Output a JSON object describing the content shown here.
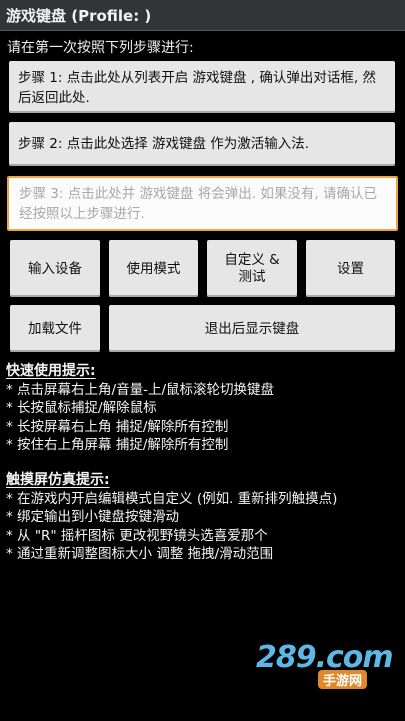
{
  "title": "游戏键盘 (Profile: )",
  "intro": "请在第一次按照下列步骤进行:",
  "steps": {
    "step1": "步骤 1: 点击此处从列表开启 游戏键盘 , 确认弹出对话框, 然后返回此处.",
    "step2": "步骤 2: 点击此处选择 游戏键盘 作为激活输入法.",
    "step3": "步骤 3: 点击此处并 游戏键盘 将会弹出. 如果没有, 请确认已经按照以上步骤进行."
  },
  "buttons": {
    "input_device": "输入设备",
    "mode": "使用模式",
    "customize_line1": "自定义 &",
    "customize_line2": "测试",
    "settings": "设置",
    "load_file": "加载文件",
    "show_keyboard": "退出后显示键盘"
  },
  "quick_tips": {
    "heading": "快速使用提示:",
    "items": [
      "* 点击屏幕右上角/音量-上/鼠标滚轮切换键盘",
      "* 长按鼠标捕捉/解除鼠标",
      "* 长按屏幕右上角 捕捉/解除所有控制",
      "* 按住右上角屏幕 捕捉/解除所有控制"
    ]
  },
  "touch_tips": {
    "heading": "触摸屏仿真提示:",
    "items": [
      "* 在游戏内开启编辑模式自定义 (例如. 重新排列触摸点)",
      "* 绑定输出到小键盘按键滑动",
      "* 从 \"R\" 摇杆图标 更改视野镜头选喜爱那个",
      "* 通过重新调整图标大小 调整 拖拽/滑动范围"
    ]
  },
  "watermark": {
    "main": "289.com",
    "sub": "手游网"
  },
  "colors": {
    "focus_border": "#f0a640",
    "title_bar": "#333437",
    "button_bg": "#e6e6e6"
  }
}
